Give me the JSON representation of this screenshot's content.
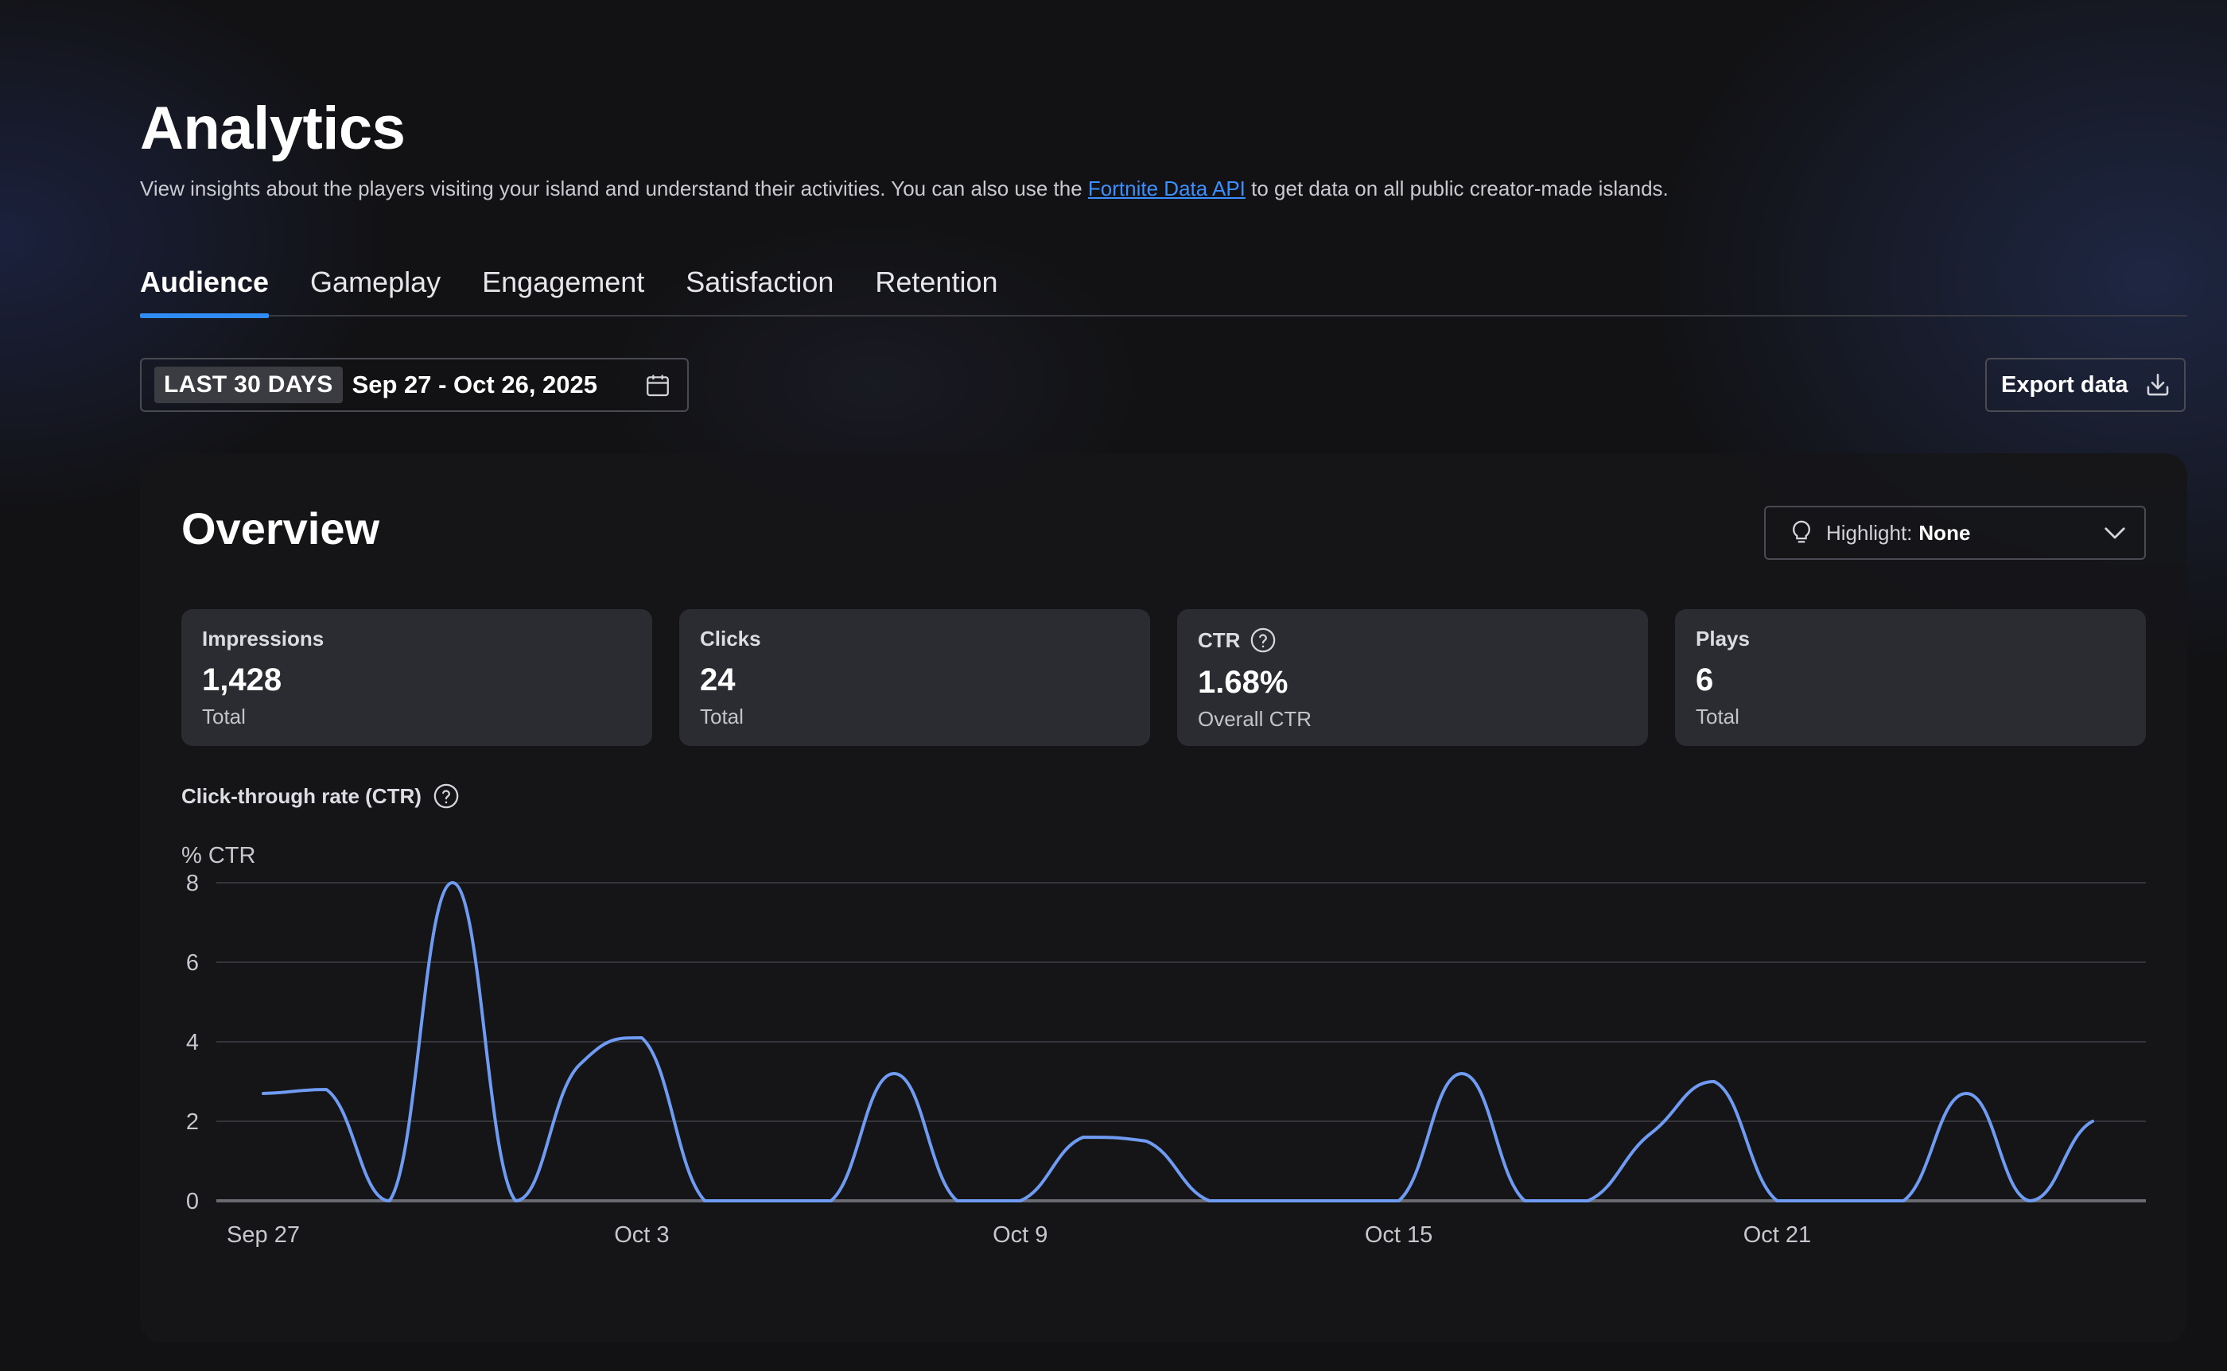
{
  "header": {
    "title": "Analytics",
    "subtitle_before": "View insights about the players visiting your island and understand their activities. You can also use the ",
    "subtitle_link": "Fortnite Data API",
    "subtitle_after": " to get data on all public creator-made islands."
  },
  "tabs": [
    {
      "label": "Audience",
      "active": true
    },
    {
      "label": "Gameplay",
      "active": false
    },
    {
      "label": "Engagement",
      "active": false
    },
    {
      "label": "Satisfaction",
      "active": false
    },
    {
      "label": "Retention",
      "active": false
    }
  ],
  "date_filter": {
    "preset": "LAST 30 DAYS",
    "range": "Sep 27 - Oct 26, 2025",
    "icon": "calendar-icon"
  },
  "export": {
    "label": "Export data",
    "icon": "download-icon"
  },
  "overview": {
    "title": "Overview",
    "highlight": {
      "label": "Highlight:",
      "value": "None",
      "icon": "lightbulb-icon"
    },
    "stats": [
      {
        "label": "Impressions",
        "value": "1,428",
        "sub": "Total"
      },
      {
        "label": "Clicks",
        "value": "24",
        "sub": "Total"
      },
      {
        "label": "CTR",
        "value": "1.68%",
        "sub": "Overall CTR",
        "help": true
      },
      {
        "label": "Plays",
        "value": "6",
        "sub": "Total"
      }
    ],
    "chart_title": "Click-through rate (CTR)"
  },
  "colors": {
    "accent": "#2f8cf5",
    "line": "#6f9cf2",
    "link": "#3d8fff"
  },
  "chart_data": {
    "type": "line",
    "ylabel": "% CTR",
    "ylim": [
      0,
      8
    ],
    "yticks": [
      0,
      2,
      4,
      6,
      8
    ],
    "tick_labels": [
      "Sep 27",
      "Oct 3",
      "Oct 9",
      "Oct 15",
      "Oct 21"
    ],
    "tick_index": [
      0,
      6,
      12,
      18,
      24
    ],
    "grid": true,
    "x": [
      "Sep 27",
      "Sep 28",
      "Sep 29",
      "Sep 30",
      "Oct 1",
      "Oct 2",
      "Oct 3",
      "Oct 4",
      "Oct 5",
      "Oct 6",
      "Oct 7",
      "Oct 8",
      "Oct 9",
      "Oct 10",
      "Oct 11",
      "Oct 12",
      "Oct 13",
      "Oct 14",
      "Oct 15",
      "Oct 16",
      "Oct 17",
      "Oct 18",
      "Oct 19",
      "Oct 20",
      "Oct 21",
      "Oct 22",
      "Oct 23",
      "Oct 24",
      "Oct 25",
      "Oct 26"
    ],
    "series": [
      {
        "values": [
          2.7,
          2.8,
          0,
          8.0,
          0,
          3.4,
          4.1,
          0,
          0,
          0,
          3.2,
          0,
          0,
          1.6,
          1.5,
          0,
          0,
          0,
          0,
          3.2,
          0,
          0,
          1.7,
          3.0,
          0,
          0,
          0,
          2.7,
          0,
          2.0
        ]
      }
    ]
  }
}
